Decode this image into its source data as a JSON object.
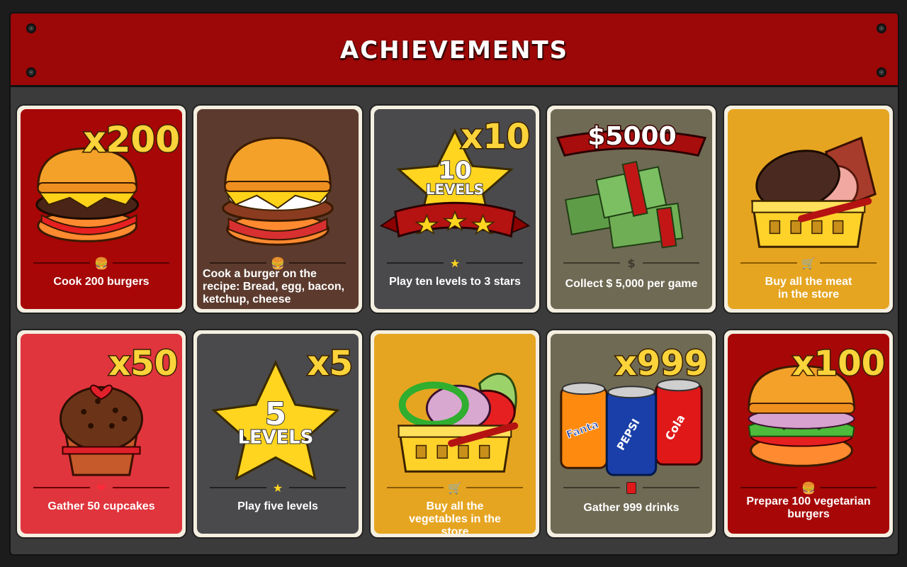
{
  "header": {
    "title": "ACHIEVEMENTS"
  },
  "achievements": [
    {
      "multiplier": "x200",
      "description": "Cook 200 burgers",
      "icon": "burger-icon",
      "theme": "#a70707"
    },
    {
      "multiplier": "",
      "description": "Cook a burger on the recipe: Bread, egg, bacon, ketchup, cheese",
      "icon": "burger-icon",
      "theme": "#5c3b2e"
    },
    {
      "multiplier": "x10",
      "star_number": "10",
      "star_label": "LEVELS",
      "description": "Play ten levels to 3 stars",
      "icon": "star-icon",
      "theme": "#4a4a4c"
    },
    {
      "multiplier": "$5000",
      "description": "Collect $ 5,000 per game",
      "icon": "dollar-icon",
      "dollar_glyph": "$",
      "theme": "#6f6a54"
    },
    {
      "multiplier": "",
      "description": "Buy all the meat in the store",
      "icon": "cart-icon",
      "theme": "#e6a521"
    },
    {
      "multiplier": "x50",
      "description": "Gather 50 cupcakes",
      "icon": "heart-icon",
      "theme": "#e0353d"
    },
    {
      "multiplier": "x5",
      "star_number": "5",
      "star_label": "LEVELS",
      "description": "Play five levels",
      "icon": "star-icon",
      "theme": "#4a4a4c"
    },
    {
      "multiplier": "",
      "description": "Buy all the vegetables in the store",
      "icon": "cart-icon",
      "theme": "#e6a521"
    },
    {
      "multiplier": "x999",
      "description": "Gather 999 drinks",
      "icon": "drink-icon",
      "theme": "#6f6a54",
      "cans": [
        "Fanta",
        "PEPSI",
        "Cola"
      ]
    },
    {
      "multiplier": "x100",
      "description": "Prepare 100 vegetarian burgers",
      "icon": "burger-icon",
      "theme": "#a70707"
    }
  ]
}
